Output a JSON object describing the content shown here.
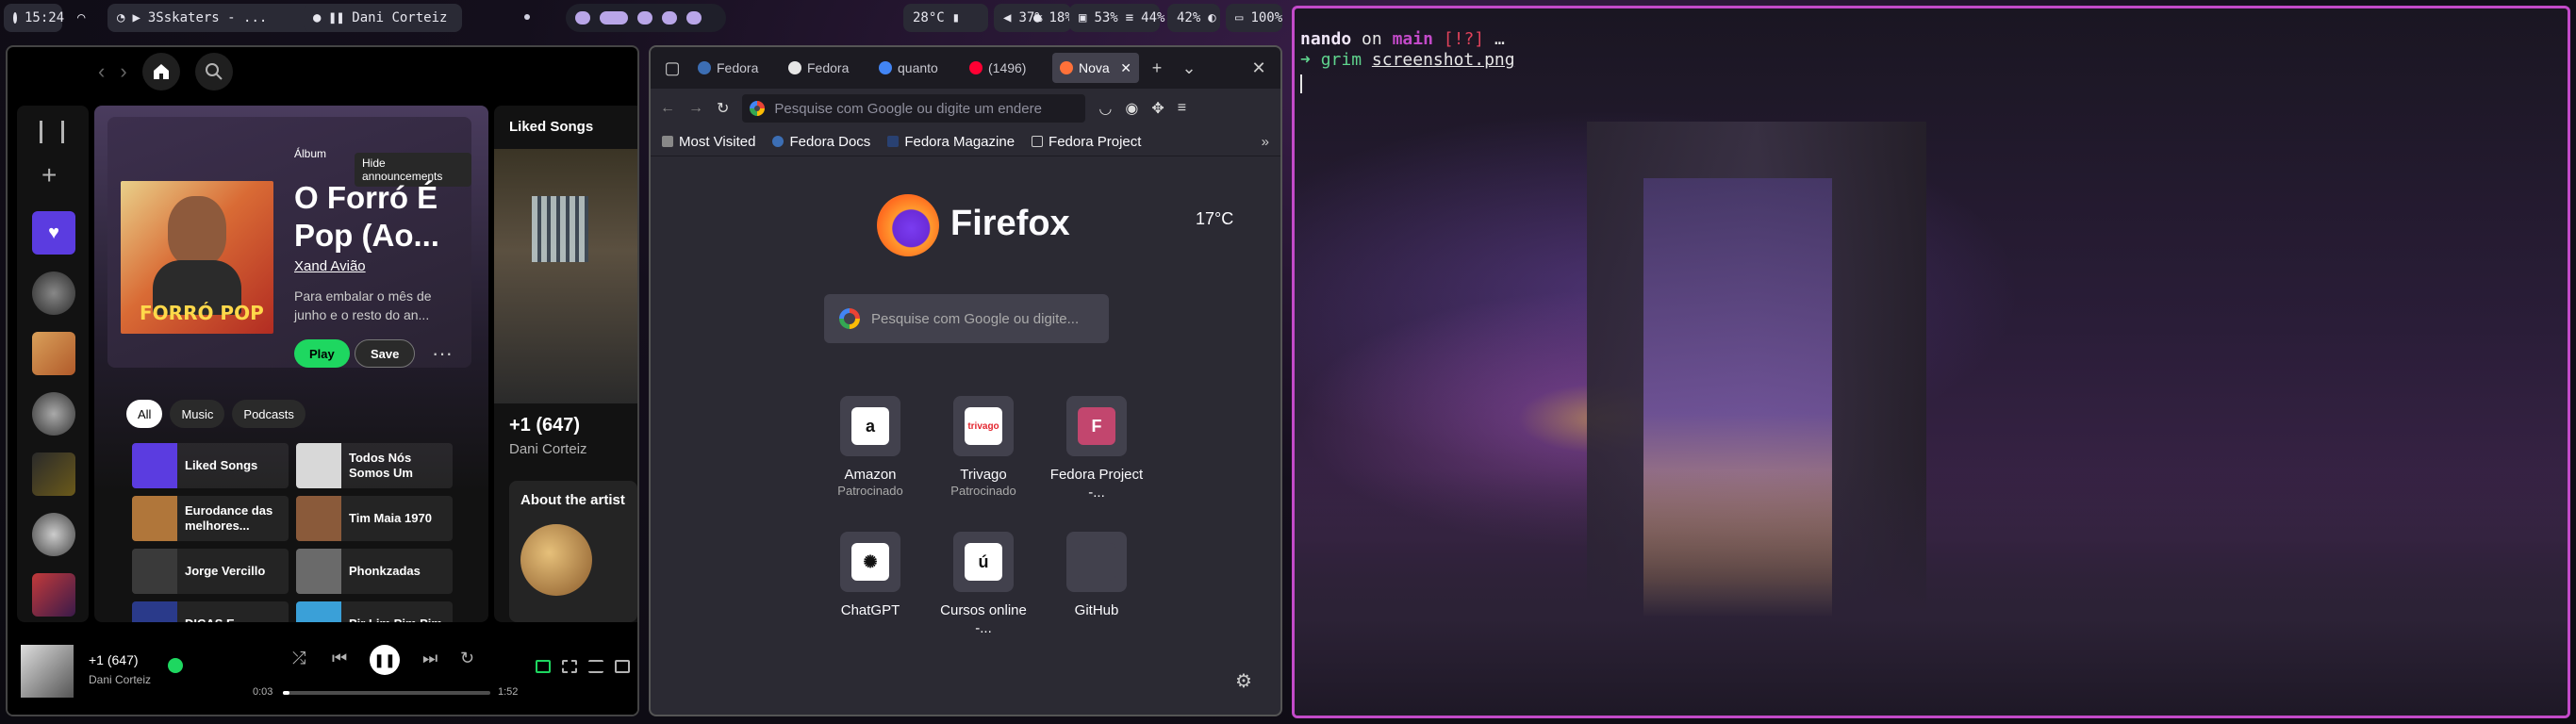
{
  "topbar": {
    "clock": "15:24",
    "media_player": "3Sskaters - ...",
    "media_track": "Dani Corteiz",
    "cpu_temp": "28°C",
    "volume": "37%",
    "mic": "18%",
    "cpu": "53%",
    "memory": "44%",
    "brightness": "42%",
    "battery": "100%"
  },
  "spotify": {
    "album": {
      "type": "Álbum",
      "tooltip": "Hide announcements",
      "title": "O Forró É Pop (Ao...",
      "artist": "Xand Avião",
      "description": "Para embalar o mês de junho e o resto do an...",
      "play_label": "Play",
      "save_label": "Save",
      "cover_text": "FORRÓ POP"
    },
    "filters": [
      "All",
      "Music",
      "Podcasts"
    ],
    "grid": [
      {
        "label": "Liked Songs",
        "color": "#5b3ce0"
      },
      {
        "label": "Todos Nós Somos Um",
        "color": "#d8d8d8"
      },
      {
        "label": "Eurodance das melhores...",
        "color": "#b0763a"
      },
      {
        "label": "Tim Maia 1970",
        "color": "#8a5a3a"
      },
      {
        "label": "Jorge Vercillo",
        "color": "#3a3a3a"
      },
      {
        "label": "Phonkzadas",
        "color": "#6a6a6a"
      },
      {
        "label": "DICAS E",
        "color": "#2a3a8a"
      },
      {
        "label": "Pir Lim Pim Pim",
        "color": "#3aa0d8"
      }
    ],
    "right_panel": {
      "label": "Liked Songs",
      "song_title": "+1 (647)",
      "song_artist": "Dani Corteiz",
      "about_title": "About the artist"
    },
    "now_playing": {
      "title": "+1 (647)",
      "artist": "Dani Corteiz",
      "elapsed": "0:03",
      "duration": "1:52",
      "progress": 0.03
    }
  },
  "firefox": {
    "tabs": [
      {
        "label": "Fedora",
        "color": "#3c6eb4"
      },
      {
        "label": "Fedora",
        "color": "#e6e6e6"
      },
      {
        "label": "quanto",
        "color": "#4285f4"
      },
      {
        "label": "(1496)",
        "color": "#ff0033"
      },
      {
        "label": "Nova",
        "color": "#ff7139"
      }
    ],
    "url_placeholder": "Pesquise com Google ou digite um endere",
    "bookmarks": [
      "Most Visited",
      "Fedora Docs",
      "Fedora Magazine",
      "Fedora Project"
    ],
    "brand": "Firefox",
    "weather": "17°C",
    "search_placeholder": "Pesquise com Google ou digite...",
    "shortcuts": [
      {
        "name": "Amazon",
        "sub": "Patrocinado",
        "glyph": "a",
        "bg": "#ffffff",
        "fg": "#111111"
      },
      {
        "name": "Trivago",
        "sub": "Patrocinado",
        "glyph": "trivago",
        "bg": "#ffffff",
        "fg": "#e3262f"
      },
      {
        "name": "Fedora Project -...",
        "sub": "",
        "glyph": "F",
        "bg": "#c2466e",
        "fg": "#ffffff"
      },
      {
        "name": "ChatGPT",
        "sub": "",
        "glyph": "✺",
        "bg": "#ffffff",
        "fg": "#111111"
      },
      {
        "name": "Cursos online -...",
        "sub": "",
        "glyph": "ú",
        "bg": "#ffffff",
        "fg": "#111111"
      },
      {
        "name": "GitHub",
        "sub": "",
        "glyph": "",
        "bg": "#42414d",
        "fg": "#ffffff"
      }
    ]
  },
  "terminal": {
    "user": "nando",
    "on": "on",
    "branch_icon": "",
    "branch": "main",
    "status": "[!?]",
    "ellipsis": "…",
    "prompt_symbol": "➜",
    "command": "grim",
    "argument": "screenshot.png"
  }
}
